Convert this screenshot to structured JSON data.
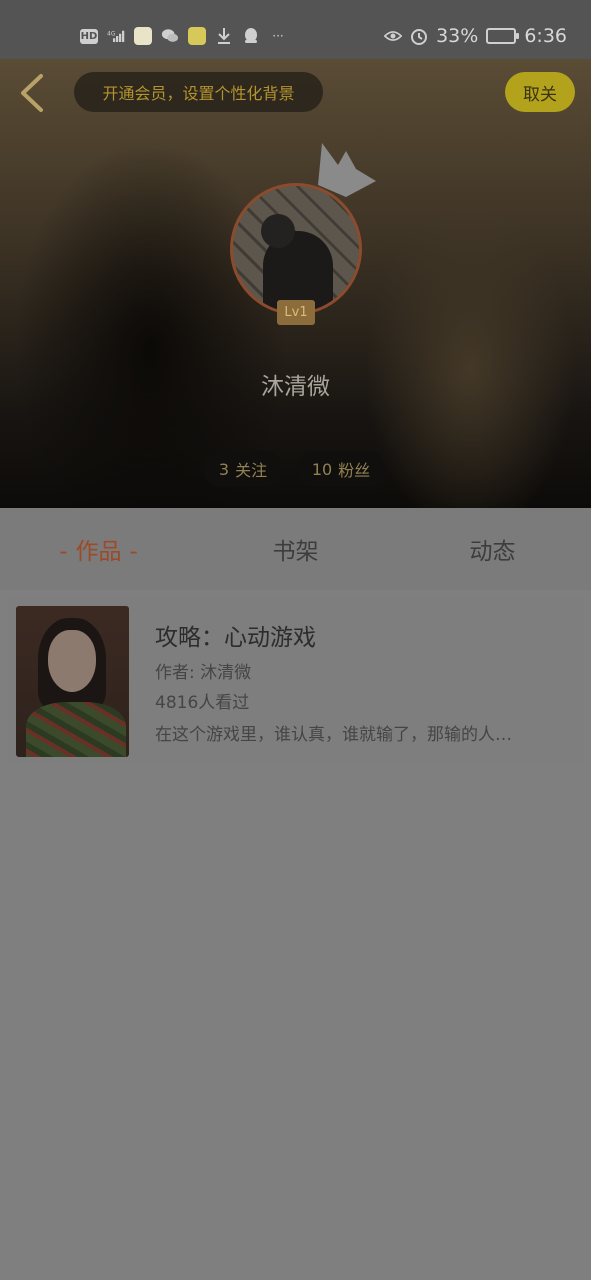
{
  "status_bar": {
    "left_icons": [
      "hd-icon",
      "4g-signal-icon",
      "app-icon",
      "wechat-icon",
      "app-icon",
      "download-icon",
      "qq-icon",
      "more-icon"
    ],
    "network": "4G",
    "battery": "33%",
    "time": "6:36"
  },
  "header": {
    "vip_prompt": "开通会员，设置个性化背景",
    "unfollow_label": "取关",
    "level": "Lv1",
    "username": "沐清微",
    "following": {
      "count": "3",
      "label": "关注"
    },
    "fans": {
      "count": "10",
      "label": "粉丝"
    }
  },
  "tabs": [
    {
      "label": "作品",
      "active": true
    },
    {
      "label": "书架",
      "active": false
    },
    {
      "label": "动态",
      "active": false
    }
  ],
  "works": [
    {
      "title": "攻略：心动游戏",
      "author": "作者: 沐清微",
      "views": "4816人看过",
      "description": "在这个游戏里，谁认真，谁就输了，那输的人…"
    }
  ],
  "colors": {
    "accent_active_tab": "#9c4a27",
    "unfollow_button": "#b3a21c",
    "vip_text": "#b2952e"
  }
}
